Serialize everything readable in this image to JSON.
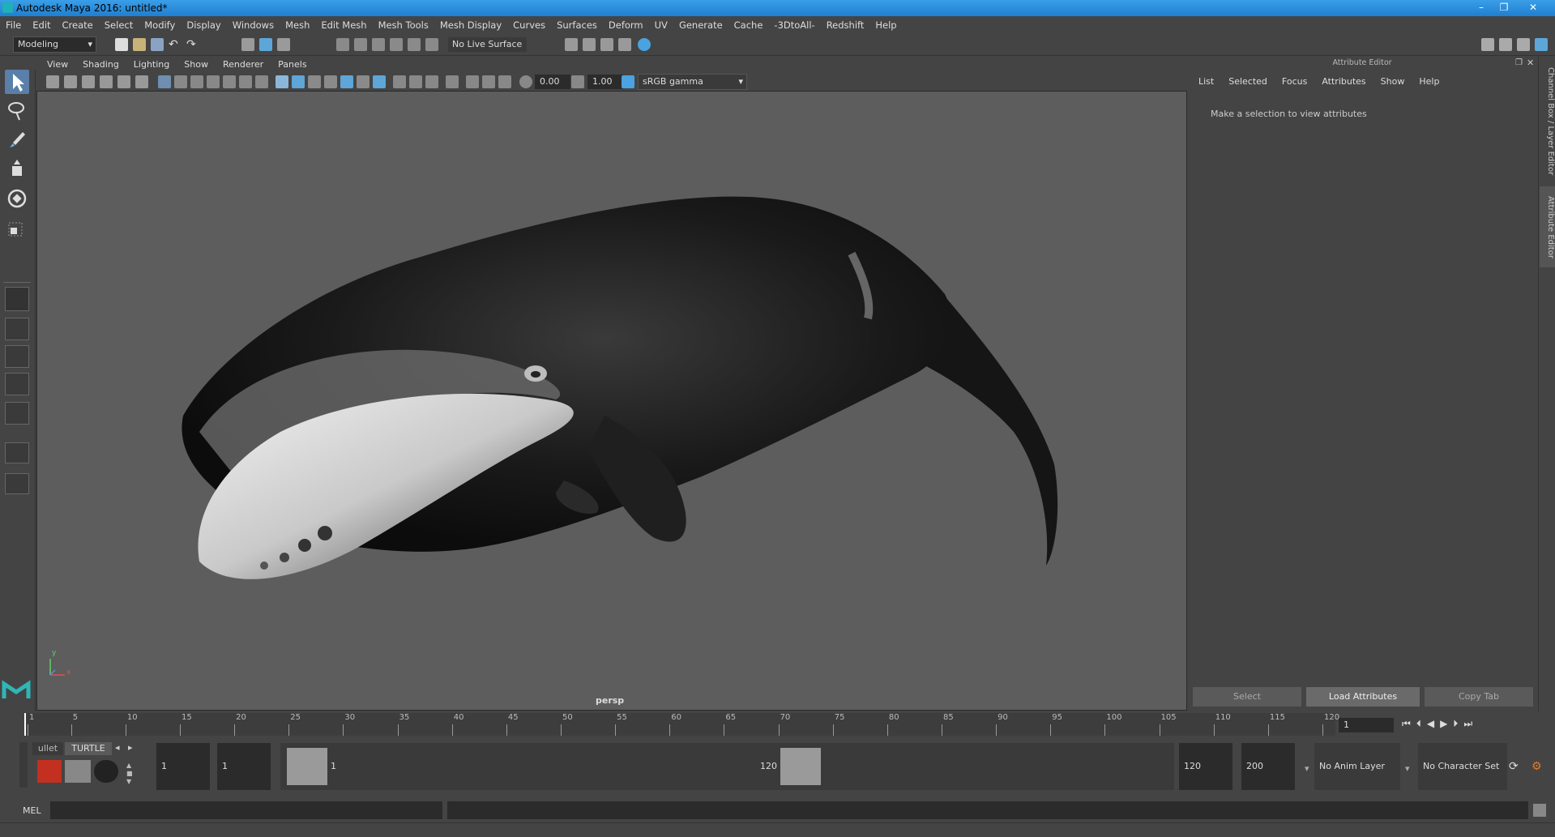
{
  "window": {
    "title": "Autodesk Maya 2016: untitled*",
    "minimize": "–",
    "restore": "❐",
    "close": "✕"
  },
  "menubar": [
    "File",
    "Edit",
    "Create",
    "Select",
    "Modify",
    "Display",
    "Windows",
    "Mesh",
    "Edit Mesh",
    "Mesh Tools",
    "Mesh Display",
    "Curves",
    "Surfaces",
    "Deform",
    "UV",
    "Generate",
    "Cache",
    "-3DtoAll-",
    "Redshift",
    "Help"
  ],
  "shelf": {
    "mode": "Modeling",
    "live_surface": "No Live Surface"
  },
  "panel_menu": [
    "View",
    "Shading",
    "Lighting",
    "Show",
    "Renderer",
    "Panels"
  ],
  "panel_toolbar": {
    "exposure": "0.00",
    "gamma": "1.00",
    "colorspace": "sRGB gamma"
  },
  "viewport": {
    "camera": "persp",
    "axis_y": "y",
    "axis_x": "x"
  },
  "attribute_editor": {
    "title": "Attribute Editor",
    "menu": [
      "List",
      "Selected",
      "Focus",
      "Attributes",
      "Show",
      "Help"
    ],
    "message": "Make a selection to view attributes",
    "buttons": {
      "select": "Select",
      "load": "Load Attributes",
      "copy": "Copy Tab"
    }
  },
  "side_tabs": {
    "channel_box": "Channel Box / Layer Editor",
    "attribute_editor": "Attribute Editor"
  },
  "timeline": {
    "ticks": [
      "1",
      "5",
      "10",
      "15",
      "20",
      "25",
      "30",
      "35",
      "40",
      "45",
      "50",
      "55",
      "60",
      "65",
      "70",
      "75",
      "80",
      "85",
      "90",
      "95",
      "100",
      "105",
      "110",
      "115",
      "120"
    ],
    "current_frame": "1"
  },
  "range": {
    "shelf_tab_bullet": "ullet",
    "shelf_tab_turtle": "TURTLE",
    "start_field": "1",
    "playback_start": "1",
    "range_start_label": "1",
    "range_end_label": "120",
    "playback_end": "120",
    "end_field": "200",
    "anim_layer": "No Anim Layer",
    "character_set": "No Character Set"
  },
  "command_line": {
    "label": "MEL"
  }
}
